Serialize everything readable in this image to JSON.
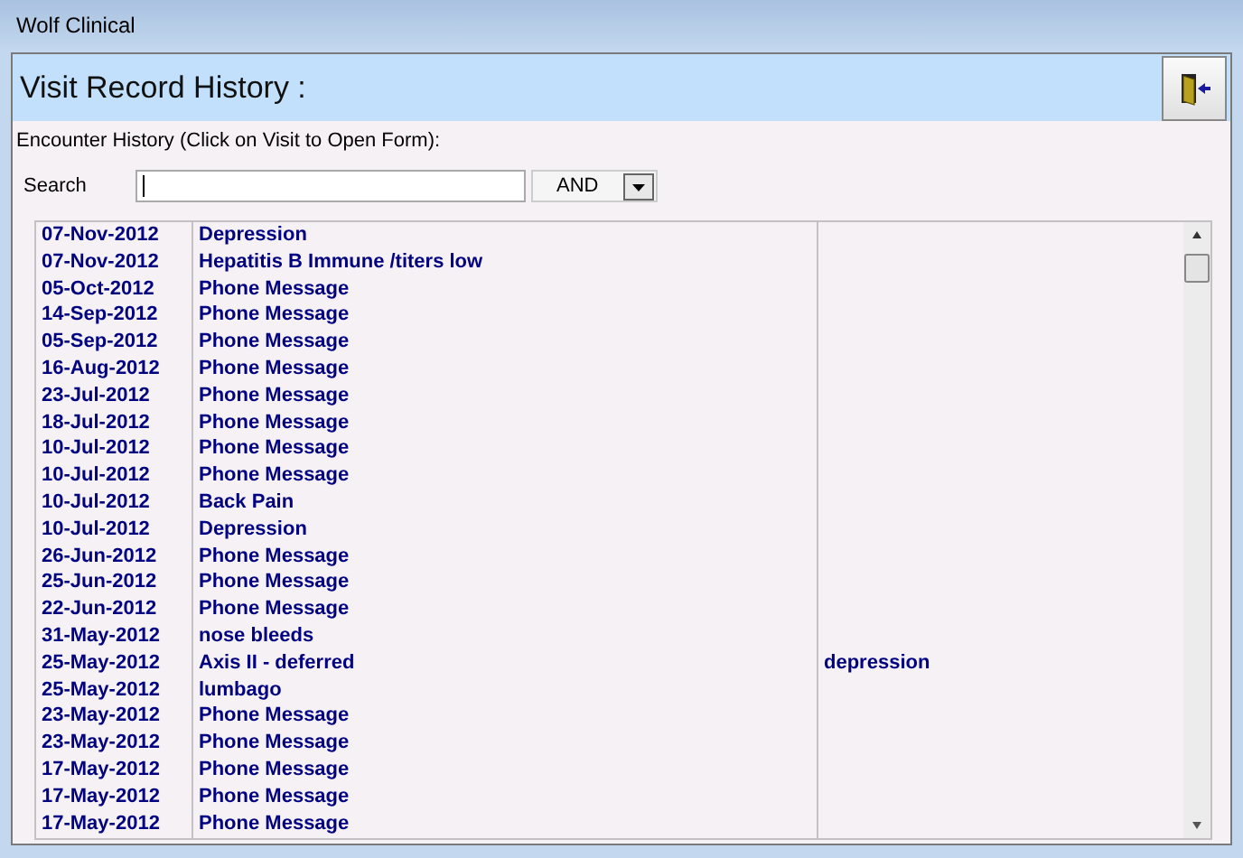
{
  "window": {
    "title": "Wolf Clinical"
  },
  "header": {
    "title": "Visit Record History :"
  },
  "instructions": "Encounter History (Click on Visit to Open Form):",
  "search": {
    "label": "Search",
    "operator": "AND"
  },
  "visits": [
    {
      "date": "07-Nov-2012",
      "description": "Depression"
    },
    {
      "date": "07-Nov-2012",
      "description": "Hepatitis B Immune /titers low"
    },
    {
      "date": "05-Oct-2012",
      "description": "Phone Message"
    },
    {
      "date": "14-Sep-2012",
      "description": "Phone Message"
    },
    {
      "date": "05-Sep-2012",
      "description": "Phone Message"
    },
    {
      "date": "16-Aug-2012",
      "description": "Phone Message"
    },
    {
      "date": "23-Jul-2012",
      "description": "Phone Message"
    },
    {
      "date": "18-Jul-2012",
      "description": "Phone Message"
    },
    {
      "date": "10-Jul-2012",
      "description": "Phone Message"
    },
    {
      "date": "10-Jul-2012",
      "description": "Phone Message"
    },
    {
      "date": "10-Jul-2012",
      "description": "Back Pain"
    },
    {
      "date": "10-Jul-2012",
      "description": "Depression"
    },
    {
      "date": "26-Jun-2012",
      "description": "Phone Message"
    },
    {
      "date": "25-Jun-2012",
      "description": "Phone Message"
    },
    {
      "date": "22-Jun-2012",
      "description": "Phone Message"
    },
    {
      "date": "31-May-2012",
      "description": "nose bleeds"
    },
    {
      "date": "25-May-2012",
      "description": "Axis II - deferred",
      "note": "depression"
    },
    {
      "date": "25-May-2012",
      "description": "lumbago"
    },
    {
      "date": "23-May-2012",
      "description": "Phone Message"
    },
    {
      "date": "23-May-2012",
      "description": "Phone Message"
    },
    {
      "date": "17-May-2012",
      "description": "Phone Message"
    },
    {
      "date": "17-May-2012",
      "description": "Phone Message"
    },
    {
      "date": "17-May-2012",
      "description": "Phone Message"
    }
  ]
}
